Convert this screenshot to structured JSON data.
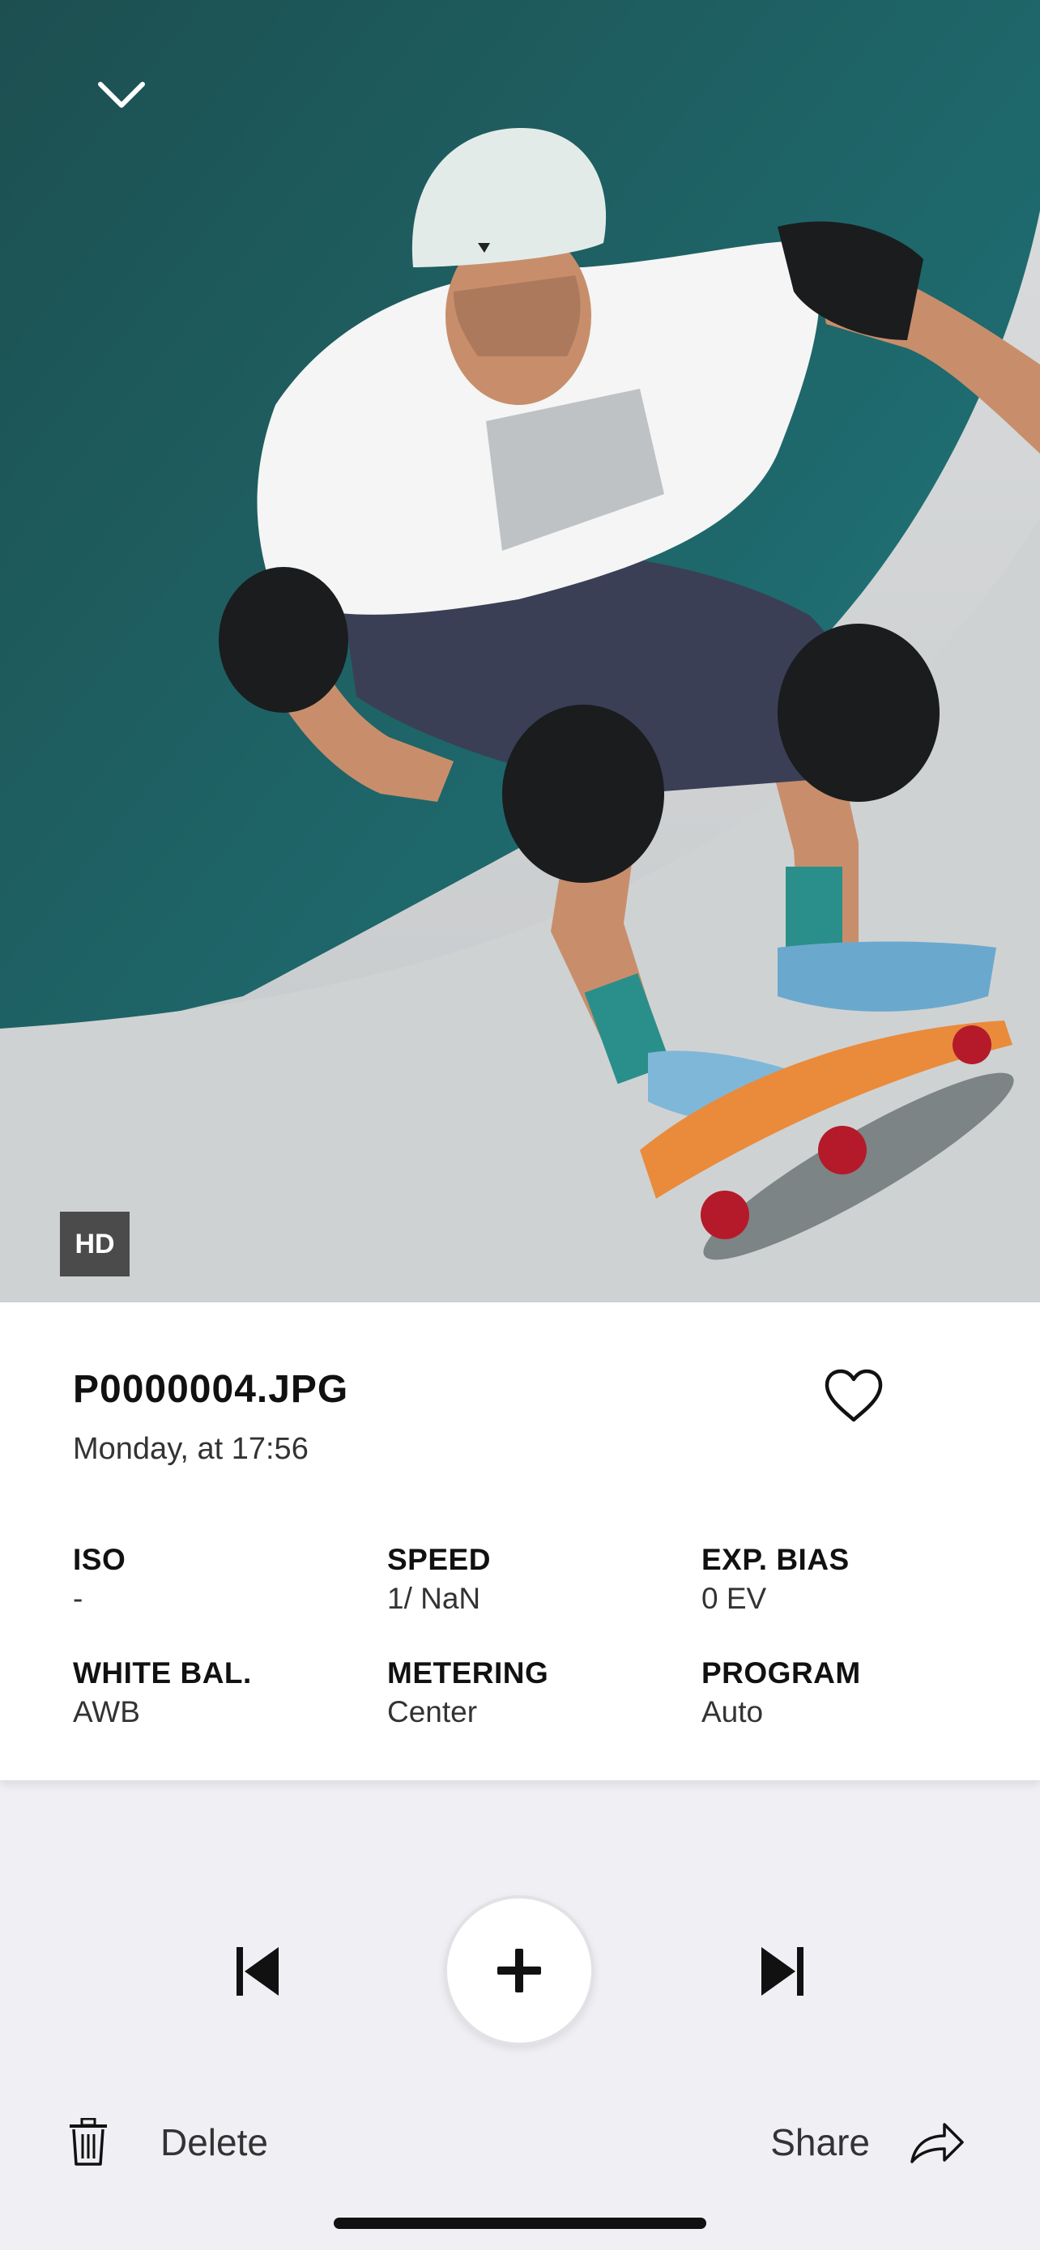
{
  "photo": {
    "badge": "HD",
    "collapse_icon": "chevron-down-icon"
  },
  "info": {
    "file_name": "P0000004.JPG",
    "date": "Monday, at 17:56",
    "favorite_icon": "heart-outline-icon",
    "meta": [
      {
        "label": "ISO",
        "value": "-"
      },
      {
        "label": "SPEED",
        "value": "1/ NaN"
      },
      {
        "label": "EXP. BIAS",
        "value": "0 EV"
      },
      {
        "label": "WHITE BAL.",
        "value": "AWB"
      },
      {
        "label": "METERING",
        "value": "Center"
      },
      {
        "label": "PROGRAM",
        "value": "Auto"
      }
    ]
  },
  "controls": {
    "prev_icon": "skip-previous-icon",
    "add_icon": "plus-icon",
    "next_icon": "skip-next-icon"
  },
  "actions": {
    "delete_label": "Delete",
    "share_label": "Share"
  },
  "colors": {
    "background": "#efeff4",
    "card": "#ffffff",
    "text": "#111111",
    "badge": "#4b4b4b"
  }
}
